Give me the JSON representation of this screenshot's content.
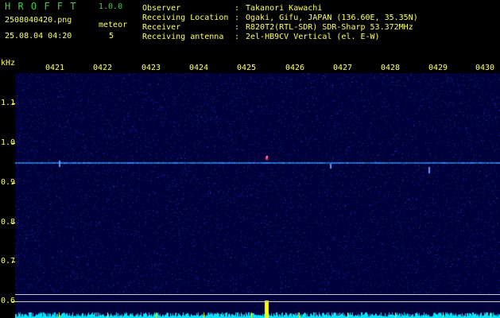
{
  "header": {
    "app_name": "H R O F F T",
    "version": "1.0.0",
    "filename": "2508040420.png",
    "meteor_label": "meteor",
    "datetime": "25.08.04 04:20",
    "meteor_count": "5"
  },
  "info": {
    "labels": [
      "Observer",
      "Receiving Location",
      "Receiver",
      "Receiving antenna"
    ],
    "separator": ":",
    "values": [
      "Takanori Kawachi",
      "Ogaki, Gifu, JAPAN (136.60E, 35.35N)",
      "R820T2(RTL-SDR) SDR-Sharp 53.372MHz",
      "2el-HB9CV Vertical (el. E-W)"
    ]
  },
  "spectrogram": {
    "y_unit": "kHz",
    "y_ticks": [
      "1.1",
      "1.0",
      "0.9",
      "0.8",
      "0.7",
      "0.6"
    ],
    "x_ticks": [
      "0421",
      "0422",
      "0423",
      "0424",
      "0425",
      "0426",
      "0427",
      "0428",
      "0429",
      "0430"
    ],
    "carrier_khz": 0.955,
    "colors": {
      "background": "#00003a",
      "carrier": "#3a8cff",
      "histogram": "#00e6ff",
      "marker": "#ffff00",
      "meteor_head": "#ff3b6b"
    }
  }
}
